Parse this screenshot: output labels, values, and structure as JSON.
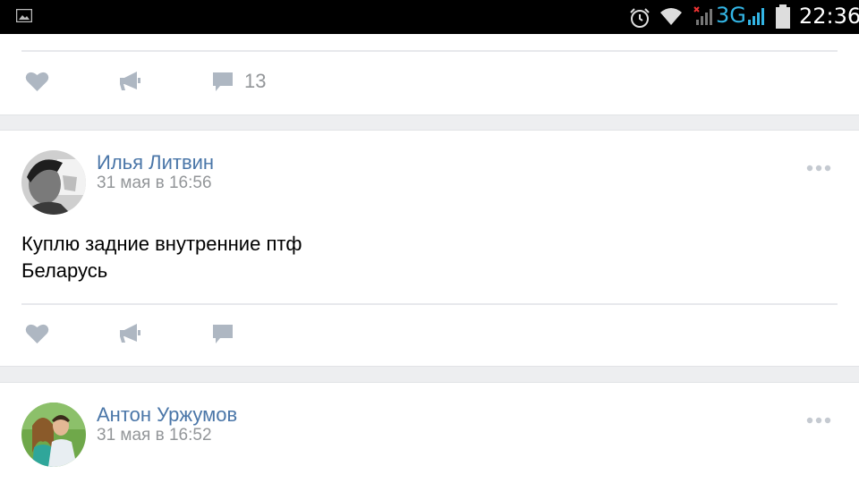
{
  "status_bar": {
    "network": "3G",
    "time": "22:36"
  },
  "feed": {
    "posts": [
      {
        "comments_count": "13"
      },
      {
        "author": "Илья Литвин",
        "date": "31 мая в 16:56",
        "text_line1": "Куплю задние внутренние птф",
        "text_line2": "Беларусь"
      },
      {
        "author": "Антон Уржумов",
        "date": "31 мая в 16:52"
      }
    ]
  },
  "colors": {
    "author_link": "#4a76a8",
    "icon_gray": "#aeb7c2",
    "meta_gray": "#939699",
    "separator": "#edeef0",
    "network_accent": "#33b5e5"
  },
  "icons": [
    "image-notification-icon",
    "alarm-icon",
    "wifi-icon",
    "cell-signal-icon",
    "battery-icon",
    "heart-icon",
    "megaphone-icon",
    "comment-icon",
    "more-icon"
  ]
}
